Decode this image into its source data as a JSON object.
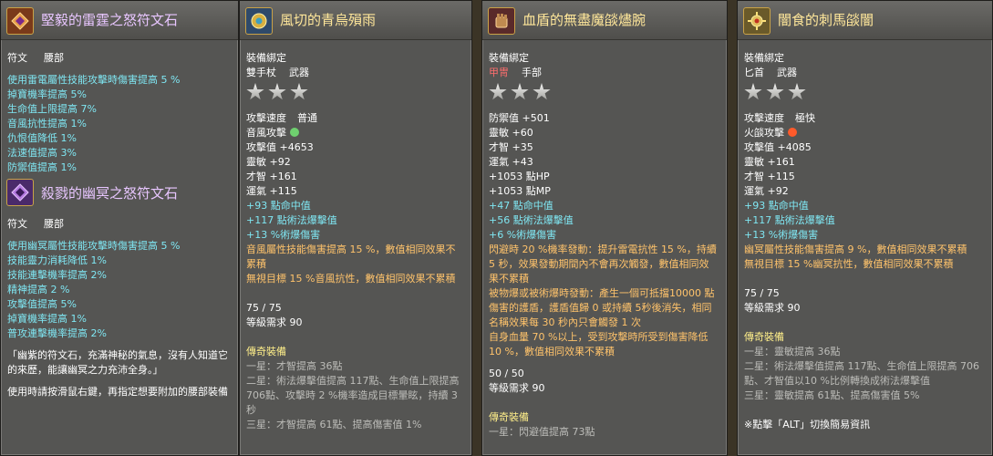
{
  "colors": {
    "panel_bg": "#555553",
    "cyan": "#7fe6f2",
    "orange": "#ffc36b",
    "gold_title": "#ffe79a",
    "purple_title": "#e8c6ff"
  },
  "p1": {
    "item1": {
      "icon": "rune-gem-icon",
      "title": "堅毅的雷霆之怒符文石",
      "type": "符文",
      "slot": "腰部",
      "stats": [
        "使用雷電屬性技能攻擊時傷害提高 5 %",
        "掉寶機率提高 5%",
        "生命值上限提高 7%",
        "音風抗性提高 1%",
        "仇恨值降低 1%",
        "法速值提高 3%",
        "防禦值提高 1%"
      ]
    },
    "item2": {
      "icon": "rune-gem-icon",
      "title": "殺戮的幽冥之怒符文石",
      "type": "符文",
      "slot": "腰部",
      "stats": [
        "使用幽冥屬性技能攻擊時傷害提高 5 %",
        "技能靈力消耗降低 1%",
        "技能連擊機率提高 2%",
        "精神提高 2 %",
        "攻擊值提高 5%",
        "掉寶機率提高 1%",
        "普攻連擊機率提高 2%"
      ]
    },
    "desc": "「幽紫的符文石，充滿神秘的氣息，沒有人知道它的來歷，能讓幽冥之力充沛全身。」",
    "usage": "使用時請按滑鼠右鍵，再指定想要附加的腰部裝備"
  },
  "p2": {
    "icon": "feather-fan-icon",
    "title": "風切的青烏殞雨",
    "bind": "裝備綁定",
    "wtype": "雙手杖",
    "wslot": "武器",
    "speed_label": "攻擊速度",
    "speed_value": "普通",
    "elem_label": "音風攻擊",
    "stats": [
      "攻擊值 +4653",
      "靈敏 +92",
      "才智 +161",
      "運氣 +115"
    ],
    "bonus": [
      "+93 點命中值",
      "+117 點術法爆擊值",
      "+13 %術爆傷害"
    ],
    "effects": [
      "音風屬性技能傷害提高 15 %，數值相同效果不累積",
      "無視目標 15 %音風抗性，數值相同效果不累積"
    ],
    "durability": "75 / 75",
    "level_req": "等級需求 90",
    "legend_title": "傳奇裝備",
    "legend": [
      "一星：才智提高 36點",
      "二星：術法爆擊值提高 117點、生命值上限提高 706點、攻擊時 2 %機率造成目標暈眩，持續 3秒",
      "三星：才智提高 61點、提高傷害值 1%"
    ]
  },
  "p3": {
    "icon": "gauntlet-icon",
    "title": "血盾的無盡魔燄燼腕",
    "bind": "裝備綁定",
    "atype": "甲冑",
    "aslot": "手部",
    "stats": [
      "防禦值 +501",
      "靈敏 +60",
      "才智 +35",
      "運氣 +43",
      "+1053 點HP",
      "+1053 點MP"
    ],
    "bonus": [
      "+47 點命中值",
      "+56 點術法爆擊值",
      "+6 %術爆傷害"
    ],
    "effects": [
      "閃避時 20 %機率發動：提升雷電抗性 15 %，持續 5 秒，效果發動期間內不會再次觸發，數值相同效果不累積",
      "被物爆或被術爆時發動：產生一個可抵擋10000 點傷害的護盾，護盾值歸 0 或持續 5秒後消失，相同名稱效果每 30 秒內只會觸發 1 次",
      "自身血量 70 %以上，受到攻擊時所受到傷害降低 10 %，數值相同效果不累積"
    ],
    "durability": "50 / 50",
    "level_req": "等級需求 90",
    "legend_title": "傳奇裝備",
    "legend_cut": "一星：閃避值提高 73點"
  },
  "p4": {
    "icon": "spiked-dagger-icon",
    "title": "闇食的刺馬燄闇",
    "bind": "裝備綁定",
    "wtype": "匕首",
    "wslot": "武器",
    "speed_label": "攻擊速度",
    "speed_value": "極快",
    "elem_label": "火燄攻擊",
    "stats": [
      "攻擊值 +4085",
      "靈敏 +161",
      "才智 +115",
      "運氣 +92"
    ],
    "bonus": [
      "+93 點命中值",
      "+117 點術法爆擊值",
      "+13 %術爆傷害"
    ],
    "effects": [
      "幽冥屬性技能傷害提高 9 %，數值相同效果不累積",
      "無視目標 15 %幽冥抗性，數值相同效果不累積"
    ],
    "durability": "75 / 75",
    "level_req": "等級需求 90",
    "legend_title": "傳奇裝備",
    "legend": [
      "一星：靈敏提高 36點",
      "二星：術法爆擊值提高 117點、生命值上限提高 706點、才智值以10 %比例轉換成術法爆擊值",
      "三星：靈敏提高 61點、提高傷害值 5%"
    ],
    "hint": "※點擊「ALT」切換簡易資訊"
  }
}
